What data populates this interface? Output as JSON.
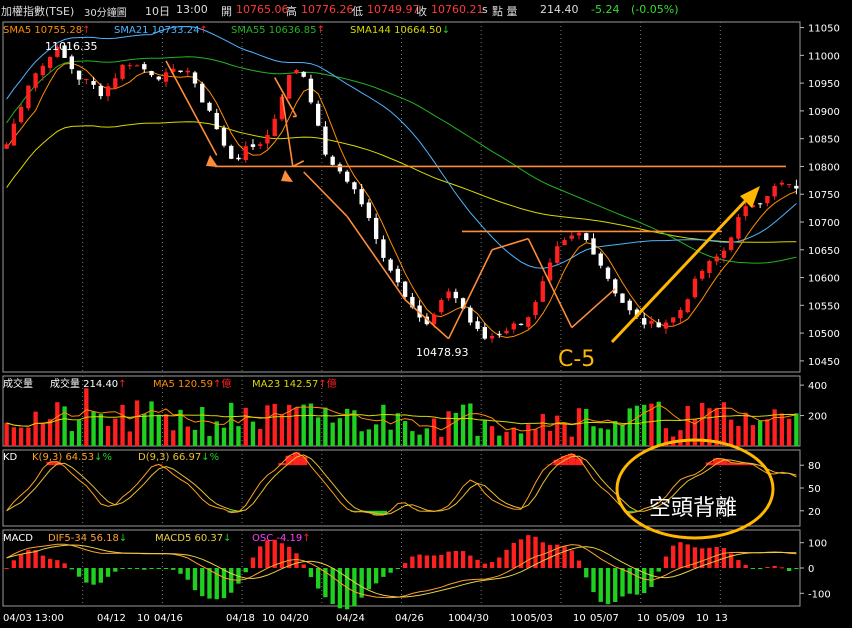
{
  "header": {
    "symbol": "加權指數(TSE)",
    "period": "30分鐘圖",
    "date": "10日",
    "time": "13:00",
    "open_label": "開",
    "open": "10765.06",
    "high_label": "高",
    "high": "10776.26",
    "low_label": "低",
    "low": "10749.97",
    "close_label": "收",
    "close": "10760.21",
    "close_flag": "s",
    "volume_label": "點 量",
    "volume": "214.40",
    "change": "-5.24",
    "change_pct": "(-0.05%)"
  },
  "colors": {
    "up": "#ff2020",
    "down": "#20d020",
    "sma5": "#ff8c00",
    "sma21": "#4fb4ff",
    "sma55": "#22b522",
    "sma144": "#d8d800",
    "k_line": "#ffa020",
    "d_line": "#e8c030",
    "dif": "#ffa030",
    "macd": "#e8d040",
    "annotation": "#ff8c3a",
    "callout": "#ffb700",
    "grid": "#7a7a7a"
  },
  "chart_data": [
    {
      "type": "candlestick",
      "panel": "price",
      "ylim": [
        10430,
        11060
      ],
      "yticks": [
        10450,
        10500,
        10550,
        10600,
        10650,
        10700,
        10750,
        10800,
        10850,
        10900,
        10950,
        11000,
        11050
      ],
      "x_ticks": [
        "04/03 13:00",
        "04/12",
        "10",
        "04/16",
        "04/18",
        "10",
        "04/20",
        "04/24",
        "04/26",
        "10",
        "04/30",
        "10",
        "05/03",
        "10",
        "05/07",
        "10",
        "05/09",
        "10",
        "13"
      ],
      "legend": [
        {
          "name": "SMA5",
          "value": "10755.28",
          "arrow": "↑"
        },
        {
          "name": "SMA21",
          "value": "10733.24",
          "arrow": "↑"
        },
        {
          "name": "SMA55",
          "value": "10636.85",
          "arrow": "↑"
        },
        {
          "name": "SMA144",
          "value": "10664.50",
          "arrow": "↓"
        }
      ],
      "close_path": [
        10840,
        10900,
        10960,
        10980,
        11016,
        10990,
        10960,
        10950,
        10930,
        10960,
        10990,
        10980,
        10970,
        10960,
        10970,
        10980,
        10930,
        10900,
        10840,
        10810,
        10830,
        10840,
        10860,
        10930,
        10980,
        10960,
        10870,
        10800,
        10790,
        10760,
        10720,
        10660,
        10620,
        10580,
        10550,
        10510,
        10540,
        10580,
        10550,
        10510,
        10490,
        10500,
        10510,
        10520,
        10540,
        10600,
        10650,
        10670,
        10680,
        10650,
        10610,
        10570,
        10540,
        10520,
        10515,
        10520,
        10530,
        10570,
        10610,
        10630,
        10650,
        10700,
        10730,
        10740,
        10760,
        10770,
        10760
      ],
      "sma_end": {
        "sma5": 10755.28,
        "sma21": 10733.24,
        "sma55": 10636.85,
        "sma144": 10664.5
      },
      "annotations": [
        {
          "label": "11016.35",
          "value": 11016.35
        },
        {
          "label": "10478.93",
          "value": 10478.93
        },
        {
          "label": "C-5"
        }
      ],
      "horizontal_levels": [
        10800,
        10683
      ]
    },
    {
      "type": "bar",
      "panel": "volume",
      "title": "成交量",
      "legend": [
        {
          "name": "成交量",
          "value": "214.40",
          "arrow": "↑"
        },
        {
          "name": "MA5",
          "value": "120.59",
          "arrow": "↑",
          "unit": "億"
        },
        {
          "name": "MA23",
          "value": "142.57",
          "arrow": "↑",
          "unit": "億"
        }
      ],
      "ylim": [
        0,
        460
      ],
      "yticks": [
        200,
        400
      ],
      "last_value": 214.4
    },
    {
      "type": "line",
      "panel": "kd",
      "title": "KD",
      "legend": [
        {
          "name": "K(9,3)",
          "value": "64.53",
          "arrow": "↓",
          "unit": "%"
        },
        {
          "name": "D(9,3)",
          "value": "66.97",
          "arrow": "↓",
          "unit": "%"
        }
      ],
      "ylim": [
        0,
        100
      ],
      "yticks": [
        20,
        50,
        80
      ],
      "k_path": [
        20,
        35,
        55,
        75,
        85,
        80,
        60,
        45,
        30,
        25,
        40,
        60,
        75,
        80,
        70,
        55,
        40,
        30,
        20,
        15,
        30,
        50,
        70,
        85,
        95,
        90,
        70,
        45,
        30,
        20,
        15,
        15,
        20,
        30,
        25,
        20,
        15,
        30,
        50,
        60,
        45,
        30,
        20,
        25,
        50,
        75,
        90,
        95,
        85,
        65,
        45,
        30,
        20,
        18,
        25,
        40,
        55,
        65,
        75,
        85,
        88,
        85,
        80,
        75,
        70,
        68,
        65
      ],
      "k_last": 64.53,
      "d_last": 66.97,
      "callout": "空頭背離"
    },
    {
      "type": "bar",
      "panel": "macd",
      "title": "MACD",
      "legend": [
        {
          "name": "DIF5-34",
          "value": "56.18",
          "arrow": "↓"
        },
        {
          "name": "MACD5",
          "value": "60.37",
          "arrow": "↓"
        },
        {
          "name": "OSC",
          "value": "-4.19",
          "arrow": "↑"
        }
      ],
      "ylim": [
        -150,
        150
      ],
      "yticks": [
        -100,
        0,
        100
      ],
      "dif_path": [
        40,
        60,
        80,
        90,
        95,
        90,
        80,
        70,
        60,
        55,
        55,
        60,
        60,
        55,
        50,
        45,
        20,
        -10,
        -40,
        -50,
        -40,
        -20,
        0,
        20,
        40,
        30,
        0,
        -30,
        -60,
        -90,
        -110,
        -120,
        -115,
        -110,
        -100,
        -95,
        -80,
        -60,
        -50,
        -50,
        -45,
        -30,
        -10,
        10,
        40,
        60,
        80,
        90,
        85,
        60,
        30,
        0,
        -20,
        -40,
        -45,
        -30,
        -10,
        10,
        30,
        45,
        55,
        60,
        65,
        62,
        60,
        58,
        56
      ],
      "dif_last": 56.18,
      "macd_last": 60.37,
      "osc_last": -4.19
    }
  ]
}
